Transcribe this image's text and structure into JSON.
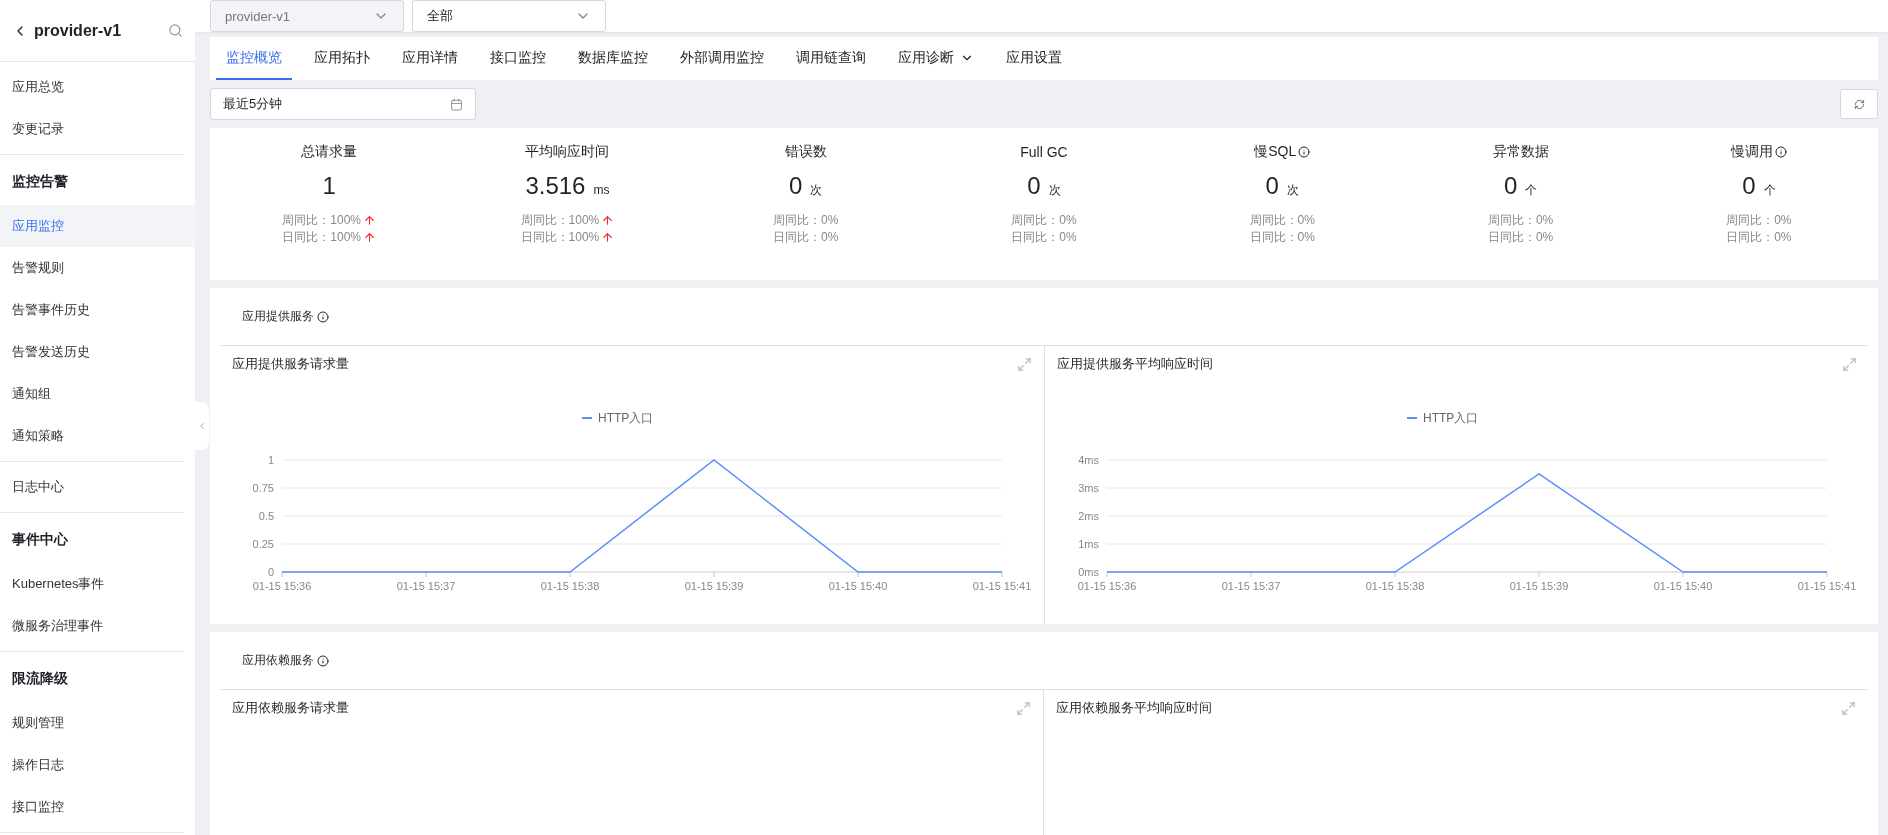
{
  "sidebar": {
    "title": "provider-v1",
    "sections": [
      {
        "items": [
          {
            "label": "应用总览",
            "selected": false
          },
          {
            "label": "变更记录",
            "selected": false
          }
        ]
      },
      {
        "title": "监控告警",
        "items": [
          {
            "label": "应用监控",
            "selected": true
          },
          {
            "label": "告警规则",
            "selected": false
          },
          {
            "label": "告警事件历史",
            "selected": false
          },
          {
            "label": "告警发送历史",
            "selected": false
          },
          {
            "label": "通知组",
            "selected": false
          },
          {
            "label": "通知策略",
            "selected": false
          }
        ]
      },
      {
        "items": [
          {
            "label": "日志中心",
            "selected": false
          }
        ]
      },
      {
        "title": "事件中心",
        "items": [
          {
            "label": "Kubernetes事件",
            "selected": false
          },
          {
            "label": "微服务治理事件",
            "selected": false
          }
        ]
      },
      {
        "title": "限流降级",
        "items": [
          {
            "label": "规则管理",
            "selected": false
          },
          {
            "label": "操作日志",
            "selected": false
          },
          {
            "label": "接口监控",
            "selected": false
          }
        ]
      }
    ]
  },
  "filters": [
    {
      "value": "provider-v1",
      "disabled": true
    },
    {
      "value": "全部",
      "disabled": false
    }
  ],
  "tabs": [
    {
      "label": "监控概览",
      "selected": true,
      "dropdown": false
    },
    {
      "label": "应用拓扑",
      "selected": false,
      "dropdown": false
    },
    {
      "label": "应用详情",
      "selected": false,
      "dropdown": false
    },
    {
      "label": "接口监控",
      "selected": false,
      "dropdown": false
    },
    {
      "label": "数据库监控",
      "selected": false,
      "dropdown": false
    },
    {
      "label": "外部调用监控",
      "selected": false,
      "dropdown": false
    },
    {
      "label": "调用链查询",
      "selected": false,
      "dropdown": false
    },
    {
      "label": "应用诊断",
      "selected": false,
      "dropdown": true
    },
    {
      "label": "应用设置",
      "selected": false,
      "dropdown": false
    }
  ],
  "time_range": {
    "value": "最近5分钟"
  },
  "stats": [
    {
      "title": "总请求量",
      "info": false,
      "value": "1",
      "week": "周同比：100%",
      "week_up": true,
      "day": "日同比：100%",
      "day_up": true
    },
    {
      "title": "平均响应时间",
      "info": false,
      "value": "3.516",
      "unit": "ms",
      "week": "周同比：100%",
      "week_up": true,
      "day": "日同比：100%",
      "day_up": true
    },
    {
      "title": "错误数",
      "info": false,
      "value": "0",
      "unit": "次",
      "week": "周同比：0%",
      "week_up": false,
      "day": "日同比：0%",
      "day_up": false
    },
    {
      "title": "Full GC",
      "info": false,
      "value": "0",
      "unit": "次",
      "week": "周同比：0%",
      "week_up": false,
      "day": "日同比：0%",
      "day_up": false
    },
    {
      "title": "慢SQL",
      "info": true,
      "value": "0",
      "unit": "次",
      "week": "周同比：0%",
      "week_up": false,
      "day": "日同比：0%",
      "day_up": false
    },
    {
      "title": "异常数据",
      "info": false,
      "value": "0",
      "unit": "个",
      "week": "周同比：0%",
      "week_up": false,
      "day": "日同比：0%",
      "day_up": false
    },
    {
      "title": "慢调用",
      "info": true,
      "value": "0",
      "unit": "个",
      "week": "周同比：0%",
      "week_up": false,
      "day": "日同比：0%",
      "day_up": false
    }
  ],
  "sections": [
    {
      "title": "应用提供服务",
      "panels": [
        {
          "title": "应用提供服务请求量",
          "chart_data": {
            "type": "line",
            "categories": [
              "01-15 15:36",
              "01-15 15:37",
              "01-15 15:38",
              "01-15 15:39",
              "01-15 15:40",
              "01-15 15:41"
            ],
            "grid": true,
            "ylim": [
              0,
              1
            ],
            "yticks": [
              0,
              0.25,
              0.5,
              0.75,
              1
            ],
            "series": [
              {
                "name": "HTTP入口",
                "color": "#5b8ff9",
                "values": [
                  0,
                  0,
                  0,
                  1,
                  0,
                  0
                ]
              }
            ]
          }
        },
        {
          "title": "应用提供服务平均响应时间",
          "chart_data": {
            "type": "line",
            "categories": [
              "01-15 15:36",
              "01-15 15:37",
              "01-15 15:38",
              "01-15 15:39",
              "01-15 15:40",
              "01-15 15:41"
            ],
            "grid": true,
            "ylim": [
              0,
              4
            ],
            "yticks": [
              {
                "value": 0,
                "label": "0ms"
              },
              {
                "value": 1,
                "label": "1ms"
              },
              {
                "value": 2,
                "label": "2ms"
              },
              {
                "value": 3,
                "label": "3ms"
              },
              {
                "value": 4,
                "label": "4ms"
              }
            ],
            "series": [
              {
                "name": "HTTP入口",
                "color": "#5b8ff9",
                "values": [
                  0,
                  0,
                  0,
                  3.5,
                  0,
                  0
                ]
              }
            ]
          }
        }
      ]
    },
    {
      "title": "应用依赖服务",
      "panels": [
        {
          "title": "应用依赖服务请求量"
        },
        {
          "title": "应用依赖服务平均响应时间"
        }
      ]
    }
  ]
}
